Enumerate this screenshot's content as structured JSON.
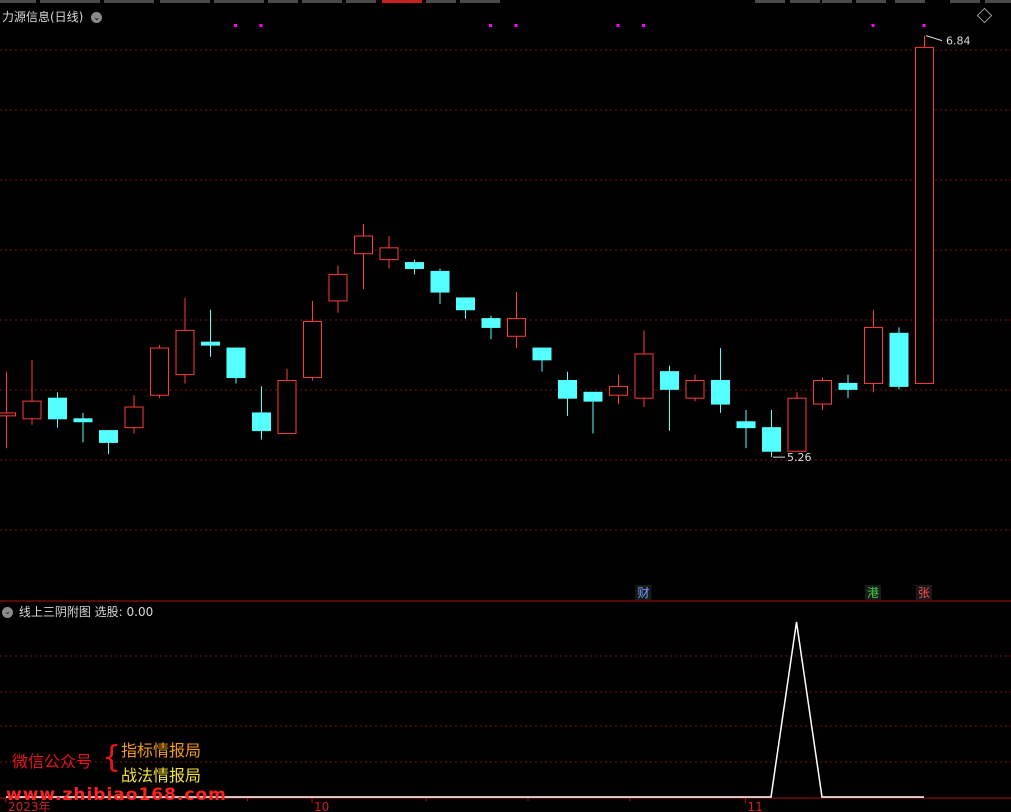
{
  "header": {
    "indicator_title": "力源信息(日线)"
  },
  "sub_panel": {
    "title": "线上三阴附图",
    "value_label": "选股: 0.00"
  },
  "watermark": {
    "wechat_label": "微信公众号",
    "brace": "{",
    "line1": "指标情报局",
    "line2": "战法情报局",
    "url": "www.zhibiao168.com"
  },
  "colors": {
    "up": "#ff3a3a",
    "down": "#54ffff",
    "grid": "#7a1010",
    "separator": "#b01010",
    "marker": "#ff00ff",
    "signal": "#ffffff"
  },
  "chart_data": [
    {
      "type": "candlestick",
      "title": "力源信息(日线)",
      "ylim": [
        5.0,
        7.0
      ],
      "max_label": "6.84",
      "min_label": "5.26",
      "candles": [
        {
          "o": 5.55,
          "c": 5.56,
          "h": 5.7,
          "l": 5.44
        },
        {
          "o": 5.54,
          "c": 5.6,
          "h": 5.74,
          "l": 5.52
        },
        {
          "o": 5.61,
          "c": 5.54,
          "h": 5.63,
          "l": 5.51
        },
        {
          "o": 5.54,
          "c": 5.53,
          "h": 5.56,
          "l": 5.46
        },
        {
          "o": 5.5,
          "c": 5.46,
          "h": 5.5,
          "l": 5.42
        },
        {
          "o": 5.51,
          "c": 5.58,
          "h": 5.62,
          "l": 5.49
        },
        {
          "o": 5.62,
          "c": 5.78,
          "h": 5.79,
          "l": 5.61
        },
        {
          "o": 5.69,
          "c": 5.84,
          "h": 5.95,
          "l": 5.66
        },
        {
          "o": 5.8,
          "c": 5.79,
          "h": 5.91,
          "l": 5.75
        },
        {
          "o": 5.78,
          "c": 5.68,
          "h": 5.78,
          "l": 5.66
        },
        {
          "o": 5.56,
          "c": 5.5,
          "h": 5.65,
          "l": 5.47
        },
        {
          "o": 5.49,
          "c": 5.67,
          "h": 5.71,
          "l": 5.49
        },
        {
          "o": 5.68,
          "c": 5.87,
          "h": 5.94,
          "l": 5.67
        },
        {
          "o": 5.94,
          "c": 6.03,
          "h": 6.06,
          "l": 5.9
        },
        {
          "o": 6.1,
          "c": 6.16,
          "h": 6.2,
          "l": 5.98
        },
        {
          "o": 6.08,
          "c": 6.12,
          "h": 6.16,
          "l": 6.05
        },
        {
          "o": 6.07,
          "c": 6.05,
          "h": 6.08,
          "l": 6.03
        },
        {
          "o": 6.04,
          "c": 5.97,
          "h": 6.05,
          "l": 5.93
        },
        {
          "o": 5.95,
          "c": 5.91,
          "h": 5.95,
          "l": 5.88
        },
        {
          "o": 5.88,
          "c": 5.85,
          "h": 5.89,
          "l": 5.81
        },
        {
          "o": 5.82,
          "c": 5.88,
          "h": 5.97,
          "l": 5.78
        },
        {
          "o": 5.78,
          "c": 5.74,
          "h": 5.78,
          "l": 5.7
        },
        {
          "o": 5.67,
          "c": 5.61,
          "h": 5.7,
          "l": 5.55
        },
        {
          "o": 5.63,
          "c": 5.6,
          "h": 5.63,
          "l": 5.49
        },
        {
          "o": 5.62,
          "c": 5.65,
          "h": 5.69,
          "l": 5.59
        },
        {
          "o": 5.61,
          "c": 5.76,
          "h": 5.84,
          "l": 5.58
        },
        {
          "o": 5.7,
          "c": 5.64,
          "h": 5.72,
          "l": 5.5
        },
        {
          "o": 5.61,
          "c": 5.67,
          "h": 5.69,
          "l": 5.6
        },
        {
          "o": 5.67,
          "c": 5.59,
          "h": 5.78,
          "l": 5.56
        },
        {
          "o": 5.53,
          "c": 5.51,
          "h": 5.57,
          "l": 5.44
        },
        {
          "o": 5.51,
          "c": 5.43,
          "h": 5.57,
          "l": 5.41
        },
        {
          "o": 5.43,
          "c": 5.61,
          "h": 5.63,
          "l": 5.43
        },
        {
          "o": 5.59,
          "c": 5.67,
          "h": 5.68,
          "l": 5.57
        },
        {
          "o": 5.66,
          "c": 5.64,
          "h": 5.69,
          "l": 5.61
        },
        {
          "o": 5.66,
          "c": 5.85,
          "h": 5.91,
          "l": 5.63
        },
        {
          "o": 5.83,
          "c": 5.65,
          "h": 5.85,
          "l": 5.64
        },
        {
          "o": 5.66,
          "c": 6.8,
          "h": 6.84,
          "l": 5.66
        }
      ],
      "top_markers": [
        9,
        10,
        19,
        20,
        24,
        25,
        34,
        36
      ],
      "event_labels": [
        {
          "index": 25,
          "text": "财",
          "color": "#6aa0ff"
        },
        {
          "index": 34,
          "text": "港",
          "color": "#3ad13a"
        },
        {
          "index": 36,
          "text": "张",
          "color": "#ff4a4a"
        }
      ]
    },
    {
      "type": "line",
      "title": "线上三阴附图",
      "series": [
        {
          "values": [
            0,
            0,
            0,
            0,
            0,
            0,
            0,
            0,
            0,
            0,
            0,
            0,
            0,
            0,
            0,
            0,
            0,
            0,
            0,
            0,
            0,
            0,
            0,
            0,
            0,
            0,
            0,
            0,
            0,
            0,
            0,
            1,
            0,
            0,
            0,
            0,
            0
          ]
        }
      ],
      "ylim": [
        0,
        1
      ],
      "x_labels": [
        {
          "index": 0,
          "text": "2023年"
        },
        {
          "index": 12,
          "text": "10"
        },
        {
          "index": 29,
          "text": "11"
        }
      ]
    }
  ]
}
